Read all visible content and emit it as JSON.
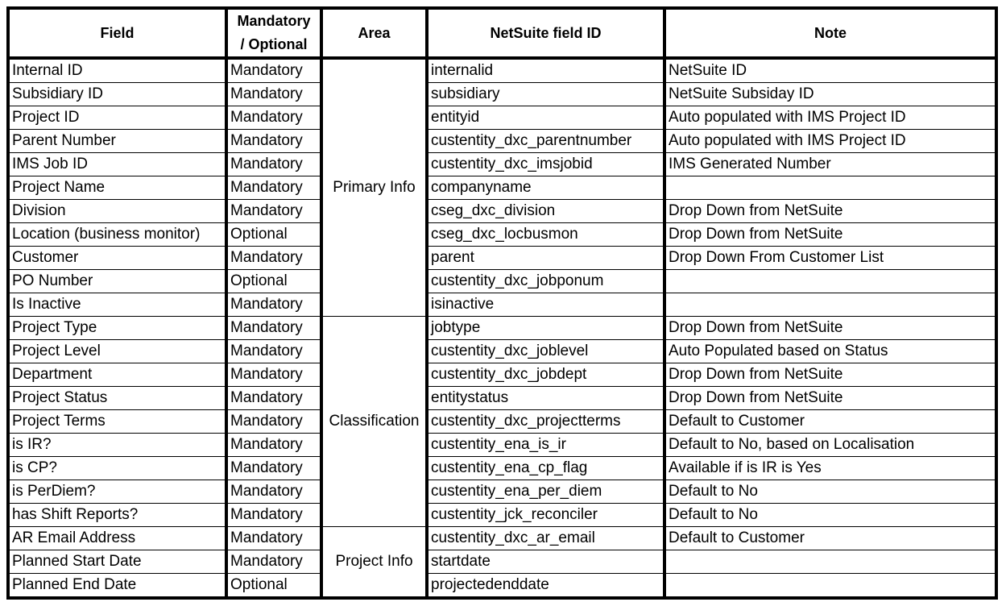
{
  "table": {
    "headers": {
      "field": "Field",
      "mandatory_line1": "Mandatory",
      "mandatory_line2": "/ Optional",
      "area": "Area",
      "netsuite_id": "NetSuite field ID",
      "note": "Note"
    },
    "areas": [
      {
        "label": "Primary Info",
        "rows": 11
      },
      {
        "label": "Classification",
        "rows": 9
      },
      {
        "label": "Project Info",
        "rows": 3
      }
    ],
    "rows": [
      {
        "field": "Internal ID",
        "requirement": "Mandatory",
        "netsuite_id": "internalid",
        "note": "NetSuite ID"
      },
      {
        "field": "Subsidiary ID",
        "requirement": "Mandatory",
        "netsuite_id": "subsidiary",
        "note": "NetSuite Subsiday ID"
      },
      {
        "field": "Project ID",
        "requirement": "Mandatory",
        "netsuite_id": "entityid",
        "note": "Auto populated with IMS Project ID"
      },
      {
        "field": "Parent Number",
        "requirement": "Mandatory",
        "netsuite_id": "custentity_dxc_parentnumber",
        "note": "Auto populated with IMS Project ID"
      },
      {
        "field": "IMS Job ID",
        "requirement": "Mandatory",
        "netsuite_id": "custentity_dxc_imsjobid",
        "note": "IMS Generated Number"
      },
      {
        "field": "Project Name",
        "requirement": "Mandatory",
        "netsuite_id": "companyname",
        "note": ""
      },
      {
        "field": "Division",
        "requirement": "Mandatory",
        "netsuite_id": "cseg_dxc_division",
        "note": "Drop Down from NetSuite"
      },
      {
        "field": "Location (business monitor)",
        "requirement": "Optional",
        "netsuite_id": "cseg_dxc_locbusmon",
        "note": "Drop Down from NetSuite"
      },
      {
        "field": "Customer",
        "requirement": "Mandatory",
        "netsuite_id": "parent",
        "note": "Drop Down From Customer List"
      },
      {
        "field": "PO Number",
        "requirement": "Optional",
        "netsuite_id": "custentity_dxc_jobponum",
        "note": ""
      },
      {
        "field": "Is Inactive",
        "requirement": "Mandatory",
        "netsuite_id": "isinactive",
        "note": ""
      },
      {
        "field": "Project Type",
        "requirement": "Mandatory",
        "netsuite_id": "jobtype",
        "note": "Drop Down from NetSuite"
      },
      {
        "field": "Project Level",
        "requirement": "Mandatory",
        "netsuite_id": "custentity_dxc_joblevel",
        "note": "Auto Populated based on Status"
      },
      {
        "field": "Department",
        "requirement": "Mandatory",
        "netsuite_id": "custentity_dxc_jobdept",
        "note": "Drop Down from NetSuite"
      },
      {
        "field": "Project Status",
        "requirement": "Mandatory",
        "netsuite_id": "entitystatus",
        "note": "Drop Down from NetSuite"
      },
      {
        "field": "Project Terms",
        "requirement": "Mandatory",
        "netsuite_id": "custentity_dxc_projectterms",
        "note": "Default to Customer"
      },
      {
        "field": "is IR?",
        "requirement": "Mandatory",
        "netsuite_id": "custentity_ena_is_ir",
        "note": "Default to No, based on Localisation"
      },
      {
        "field": "is CP?",
        "requirement": "Mandatory",
        "netsuite_id": "custentity_ena_cp_flag",
        "note": "Available if is IR is Yes"
      },
      {
        "field": "is PerDiem?",
        "requirement": "Mandatory",
        "netsuite_id": "custentity_ena_per_diem",
        "note": "Default to No"
      },
      {
        "field": "has Shift Reports?",
        "requirement": "Mandatory",
        "netsuite_id": "custentity_jck_reconciler",
        "note": "Default to No"
      },
      {
        "field": "AR Email Address",
        "requirement": "Mandatory",
        "netsuite_id": "custentity_dxc_ar_email",
        "note": "Default to Customer"
      },
      {
        "field": "Planned Start Date",
        "requirement": "Mandatory",
        "netsuite_id": "startdate",
        "note": ""
      },
      {
        "field": "Planned End Date",
        "requirement": "Optional",
        "netsuite_id": "projectedenddate",
        "note": ""
      }
    ]
  }
}
